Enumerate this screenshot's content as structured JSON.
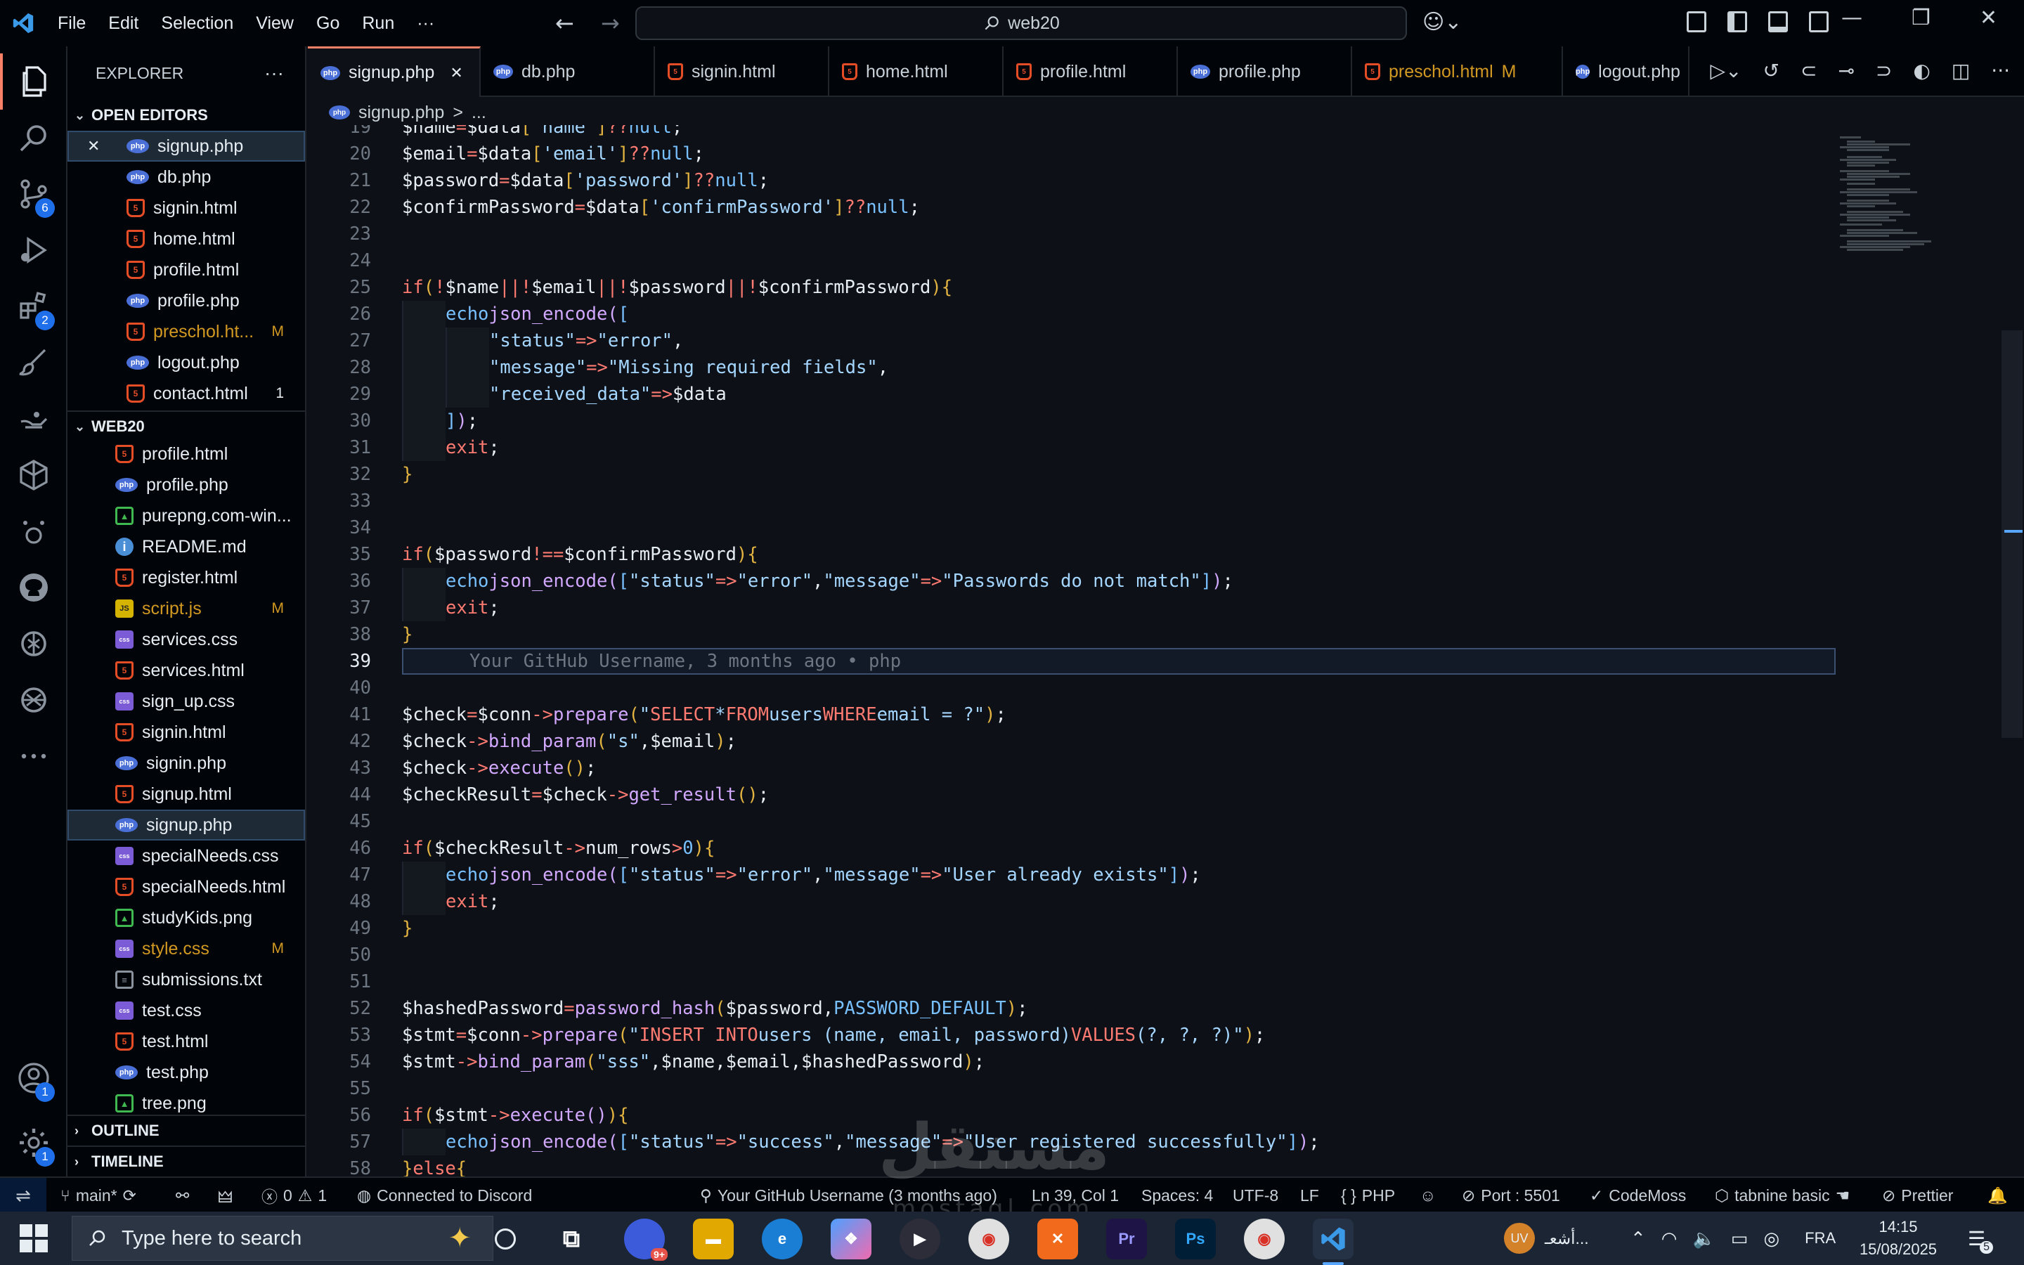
{
  "menu": [
    "File",
    "Edit",
    "Selection",
    "View",
    "Go",
    "Run",
    "···"
  ],
  "search": {
    "value": "web20"
  },
  "explorer": {
    "title": "EXPLORER",
    "open_editors_label": "OPEN EDITORS",
    "open_editors": [
      {
        "name": "signup.php",
        "type": "php",
        "selected": true,
        "close": true
      },
      {
        "name": "db.php",
        "type": "php"
      },
      {
        "name": "signin.html",
        "type": "html"
      },
      {
        "name": "home.html",
        "type": "html"
      },
      {
        "name": "profile.html",
        "type": "html"
      },
      {
        "name": "profile.php",
        "type": "php"
      },
      {
        "name": "preschol.ht...",
        "type": "html",
        "modified": true,
        "flag": "M"
      },
      {
        "name": "logout.php",
        "type": "php"
      },
      {
        "name": "contact.html",
        "type": "html",
        "flag": "1"
      }
    ],
    "folder_label": "WEB20",
    "folder_files": [
      {
        "name": "profile.html",
        "type": "html"
      },
      {
        "name": "profile.php",
        "type": "php"
      },
      {
        "name": "purepng.com-win...",
        "type": "img"
      },
      {
        "name": "README.md",
        "type": "info"
      },
      {
        "name": "register.html",
        "type": "html"
      },
      {
        "name": "script.js",
        "type": "js",
        "modified": true,
        "flag": "M"
      },
      {
        "name": "services.css",
        "type": "css"
      },
      {
        "name": "services.html",
        "type": "html"
      },
      {
        "name": "sign_up.css",
        "type": "css"
      },
      {
        "name": "signin.html",
        "type": "html"
      },
      {
        "name": "signin.php",
        "type": "php"
      },
      {
        "name": "signup.html",
        "type": "html"
      },
      {
        "name": "signup.php",
        "type": "php",
        "selected": true
      },
      {
        "name": "specialNeeds.css",
        "type": "css"
      },
      {
        "name": "specialNeeds.html",
        "type": "html"
      },
      {
        "name": "studyKids.png",
        "type": "img"
      },
      {
        "name": "style.css",
        "type": "css",
        "modified": true,
        "flag": "M"
      },
      {
        "name": "submissions.txt",
        "type": "txt"
      },
      {
        "name": "test.css",
        "type": "css"
      },
      {
        "name": "test.html",
        "type": "html"
      },
      {
        "name": "test.php",
        "type": "php"
      },
      {
        "name": "tree.png",
        "type": "img"
      }
    ],
    "outline_label": "OUTLINE",
    "timeline_label": "TIMELINE"
  },
  "activity_badges": {
    "source_control": "6",
    "extensions": "2",
    "accounts": "1",
    "manage": "1"
  },
  "tabs": [
    {
      "name": "signup.php",
      "type": "php",
      "active": true
    },
    {
      "name": "db.php",
      "type": "php"
    },
    {
      "name": "signin.html",
      "type": "html"
    },
    {
      "name": "home.html",
      "type": "html"
    },
    {
      "name": "profile.html",
      "type": "html"
    },
    {
      "name": "profile.php",
      "type": "php"
    },
    {
      "name": "preschol.html",
      "type": "html",
      "modified": true,
      "flag": "M"
    },
    {
      "name": "logout.php",
      "type": "php"
    }
  ],
  "breadcrumb": {
    "file": "signup.php",
    "sep": ">",
    "rest": "..."
  },
  "editor": {
    "current_line": 39,
    "blame": "Your GitHub Username, 3 months ago • php",
    "lines": [
      {
        "n": 19,
        "html": "<span class=\"v\">$name</span> <span class=\"k\">=</span> <span class=\"v\">$data</span><span class=\"p\">[</span><span class=\"s\">'name'</span><span class=\"p\">]</span> <span class=\"k\">??</span> <span class=\"c\">null</span><span class=\"v\">;</span>"
      },
      {
        "n": 20,
        "html": "<span class=\"v\">$email</span> <span class=\"k\">=</span> <span class=\"v\">$data</span><span class=\"p\">[</span><span class=\"s\">'email'</span><span class=\"p\">]</span> <span class=\"k\">??</span> <span class=\"c\">null</span><span class=\"v\">;</span>"
      },
      {
        "n": 21,
        "html": "<span class=\"v\">$password</span> <span class=\"k\">=</span> <span class=\"v\">$data</span><span class=\"p\">[</span><span class=\"s\">'password'</span><span class=\"p\">]</span> <span class=\"k\">??</span> <span class=\"c\">null</span><span class=\"v\">;</span>"
      },
      {
        "n": 22,
        "html": "<span class=\"v\">$confirmPassword</span> <span class=\"k\">=</span> <span class=\"v\">$data</span><span class=\"p\">[</span><span class=\"s\">'confirmPassword'</span><span class=\"p\">]</span> <span class=\"k\">??</span> <span class=\"c\">null</span><span class=\"v\">;</span>"
      },
      {
        "n": 23,
        "html": ""
      },
      {
        "n": 24,
        "html": ""
      },
      {
        "n": 25,
        "html": "<span class=\"k\">if</span> <span class=\"p\">(</span><span class=\"k\">!</span><span class=\"v\">$name</span> <span class=\"k\">||</span> <span class=\"k\">!</span><span class=\"v\">$email</span> <span class=\"k\">||</span> <span class=\"k\">!</span><span class=\"v\">$password</span> <span class=\"k\">||</span> <span class=\"k\">!</span><span class=\"v\">$confirmPassword</span><span class=\"p\">)</span> <span class=\"p\">{</span>"
      },
      {
        "n": 26,
        "indent": 1,
        "html": "<span class=\"c\">echo</span> <span class=\"f\">json_encode</span><span class=\"f\">(</span><span class=\"c\">[</span>"
      },
      {
        "n": 27,
        "indent": 2,
        "html": "<span class=\"s\">\"status\"</span> <span class=\"k\">=&gt;</span> <span class=\"s\">\"error\"</span><span class=\"v\">,</span>"
      },
      {
        "n": 28,
        "indent": 2,
        "html": "<span class=\"s\">\"message\"</span> <span class=\"k\">=&gt;</span> <span class=\"s\">\"Missing required fields\"</span><span class=\"v\">,</span>"
      },
      {
        "n": 29,
        "indent": 2,
        "html": "<span class=\"s\">\"received_data\"</span> <span class=\"k\">=&gt;</span> <span class=\"v\">$data</span>"
      },
      {
        "n": 30,
        "indent": 1,
        "html": "<span class=\"c\">]</span><span class=\"f\">)</span><span class=\"v\">;</span>"
      },
      {
        "n": 31,
        "indent": 1,
        "html": "<span class=\"k\">exit</span><span class=\"v\">;</span>"
      },
      {
        "n": 32,
        "html": "<span class=\"p\">}</span>"
      },
      {
        "n": 33,
        "html": ""
      },
      {
        "n": 34,
        "html": ""
      },
      {
        "n": 35,
        "html": "<span class=\"k\">if</span> <span class=\"p\">(</span><span class=\"v\">$password</span> <span class=\"k\">!==</span> <span class=\"v\">$confirmPassword</span><span class=\"p\">)</span> <span class=\"p\">{</span>"
      },
      {
        "n": 36,
        "indent": 1,
        "html": "<span class=\"c\">echo</span> <span class=\"f\">json_encode</span><span class=\"f\">(</span><span class=\"c\">[</span><span class=\"s\">\"status\"</span> <span class=\"k\">=&gt;</span> <span class=\"s\">\"error\"</span><span class=\"v\">,</span> <span class=\"s\">\"message\"</span> <span class=\"k\">=&gt;</span> <span class=\"s\">\"Passwords do not match\"</span><span class=\"c\">]</span><span class=\"f\">)</span><span class=\"v\">;</span>"
      },
      {
        "n": 37,
        "indent": 1,
        "html": "<span class=\"k\">exit</span><span class=\"v\">;</span>"
      },
      {
        "n": 38,
        "html": "<span class=\"p\">}</span>"
      },
      {
        "n": 39,
        "current": true,
        "html": ""
      },
      {
        "n": 40,
        "html": ""
      },
      {
        "n": 41,
        "html": "<span class=\"v\">$check</span> <span class=\"k\">=</span> <span class=\"v\">$conn</span><span class=\"k\">-&gt;</span><span class=\"f\">prepare</span><span class=\"p\">(</span><span class=\"s\">\"</span><span class=\"k\">SELECT</span> <span class=\"s\">*</span> <span class=\"k\">FROM</span> <span class=\"s\">users</span> <span class=\"k\">WHERE</span> <span class=\"s\">email = ?\"</span><span class=\"p\">)</span><span class=\"v\">;</span>"
      },
      {
        "n": 42,
        "html": "<span class=\"v\">$check</span><span class=\"k\">-&gt;</span><span class=\"f\">bind_param</span><span class=\"p\">(</span><span class=\"s\">\"s\"</span><span class=\"v\">,</span> <span class=\"v\">$email</span><span class=\"p\">)</span><span class=\"v\">;</span>"
      },
      {
        "n": 43,
        "html": "<span class=\"v\">$check</span><span class=\"k\">-&gt;</span><span class=\"f\">execute</span><span class=\"p\">()</span><span class=\"v\">;</span>"
      },
      {
        "n": 44,
        "html": "<span class=\"v\">$checkResult</span> <span class=\"k\">=</span> <span class=\"v\">$check</span><span class=\"k\">-&gt;</span><span class=\"f\">get_result</span><span class=\"p\">()</span><span class=\"v\">;</span>"
      },
      {
        "n": 45,
        "html": ""
      },
      {
        "n": 46,
        "html": "<span class=\"k\">if</span> <span class=\"p\">(</span><span class=\"v\">$checkResult</span><span class=\"k\">-&gt;</span><span class=\"v\">num_rows</span> <span class=\"k\">&gt;</span> <span class=\"c\">0</span><span class=\"p\">)</span> <span class=\"p\">{</span>"
      },
      {
        "n": 47,
        "indent": 1,
        "html": "<span class=\"c\">echo</span> <span class=\"f\">json_encode</span><span class=\"f\">(</span><span class=\"c\">[</span><span class=\"s\">\"status\"</span> <span class=\"k\">=&gt;</span> <span class=\"s\">\"error\"</span><span class=\"v\">,</span> <span class=\"s\">\"message\"</span> <span class=\"k\">=&gt;</span> <span class=\"s\">\"User already exists\"</span><span class=\"c\">]</span><span class=\"f\">)</span><span class=\"v\">;</span>"
      },
      {
        "n": 48,
        "indent": 1,
        "html": "<span class=\"k\">exit</span><span class=\"v\">;</span>"
      },
      {
        "n": 49,
        "html": "<span class=\"p\">}</span>"
      },
      {
        "n": 50,
        "html": ""
      },
      {
        "n": 51,
        "html": ""
      },
      {
        "n": 52,
        "html": "<span class=\"v\">$hashedPassword</span> <span class=\"k\">=</span> <span class=\"f\">password_hash</span><span class=\"p\">(</span><span class=\"v\">$password</span><span class=\"v\">,</span> <span class=\"c\">PASSWORD_DEFAULT</span><span class=\"p\">)</span><span class=\"v\">;</span>"
      },
      {
        "n": 53,
        "html": "<span class=\"v\">$stmt</span> <span class=\"k\">=</span> <span class=\"v\">$conn</span><span class=\"k\">-&gt;</span><span class=\"f\">prepare</span><span class=\"p\">(</span><span class=\"s\">\"</span><span class=\"k\">INSERT INTO</span> <span class=\"s\">users (name, email, password)</span> <span class=\"k\">VALUES</span> <span class=\"s\">(?, ?, ?)\"</span><span class=\"p\">)</span><span class=\"v\">;</span>"
      },
      {
        "n": 54,
        "html": "<span class=\"v\">$stmt</span><span class=\"k\">-&gt;</span><span class=\"f\">bind_param</span><span class=\"p\">(</span><span class=\"s\">\"sss\"</span><span class=\"v\">,</span> <span class=\"v\">$name</span><span class=\"v\">,</span> <span class=\"v\">$email</span><span class=\"v\">,</span> <span class=\"v\">$hashedPassword</span><span class=\"p\">)</span><span class=\"v\">;</span>"
      },
      {
        "n": 55,
        "html": ""
      },
      {
        "n": 56,
        "html": "<span class=\"k\">if</span> <span class=\"p\">(</span><span class=\"v\">$stmt</span><span class=\"k\">-&gt;</span><span class=\"f\">execute</span><span class=\"f\">()</span><span class=\"p\">)</span> <span class=\"p\">{</span>"
      },
      {
        "n": 57,
        "indent": 1,
        "html": "<span class=\"c\">echo</span> <span class=\"f\">json_encode</span><span class=\"f\">(</span><span class=\"c\">[</span><span class=\"s\">\"status\"</span> <span class=\"k\">=&gt;</span> <span class=\"s\">\"success\"</span><span class=\"v\">,</span> <span class=\"s\">\"message\"</span> <span class=\"k\">=&gt;</span> <span class=\"s\">\"User registered successfully\"</span><span class=\"c\">]</span><span class=\"f\">)</span><span class=\"v\">;</span>"
      },
      {
        "n": 58,
        "html": "<span class=\"p\">}</span> <span class=\"k\">else</span> <span class=\"p\">{</span>"
      }
    ]
  },
  "statusbar": {
    "branch": "main*",
    "problems": {
      "errors": "0",
      "warnings": "1"
    },
    "discord": "Connected to Discord",
    "blame": "Your GitHub Username (3 months ago)",
    "position": "Ln 39, Col 1",
    "spaces": "Spaces: 4",
    "encoding": "UTF-8",
    "eol": "LF",
    "language": "PHP",
    "port": "Port : 5501",
    "codemoss": "CodeMoss",
    "tabnine": "tabnine basic",
    "prettier": "Prettier"
  },
  "taskbar": {
    "search_placeholder": "Type here to search",
    "avatar": "UV",
    "notification_text": "أشعـ...",
    "language": "FRA",
    "time": "14:15",
    "date": "15/08/2025",
    "notif_count": "5",
    "app_badge": "9+"
  },
  "watermark": {
    "arabic": "مستقل",
    "latin": "mostaql.com"
  }
}
